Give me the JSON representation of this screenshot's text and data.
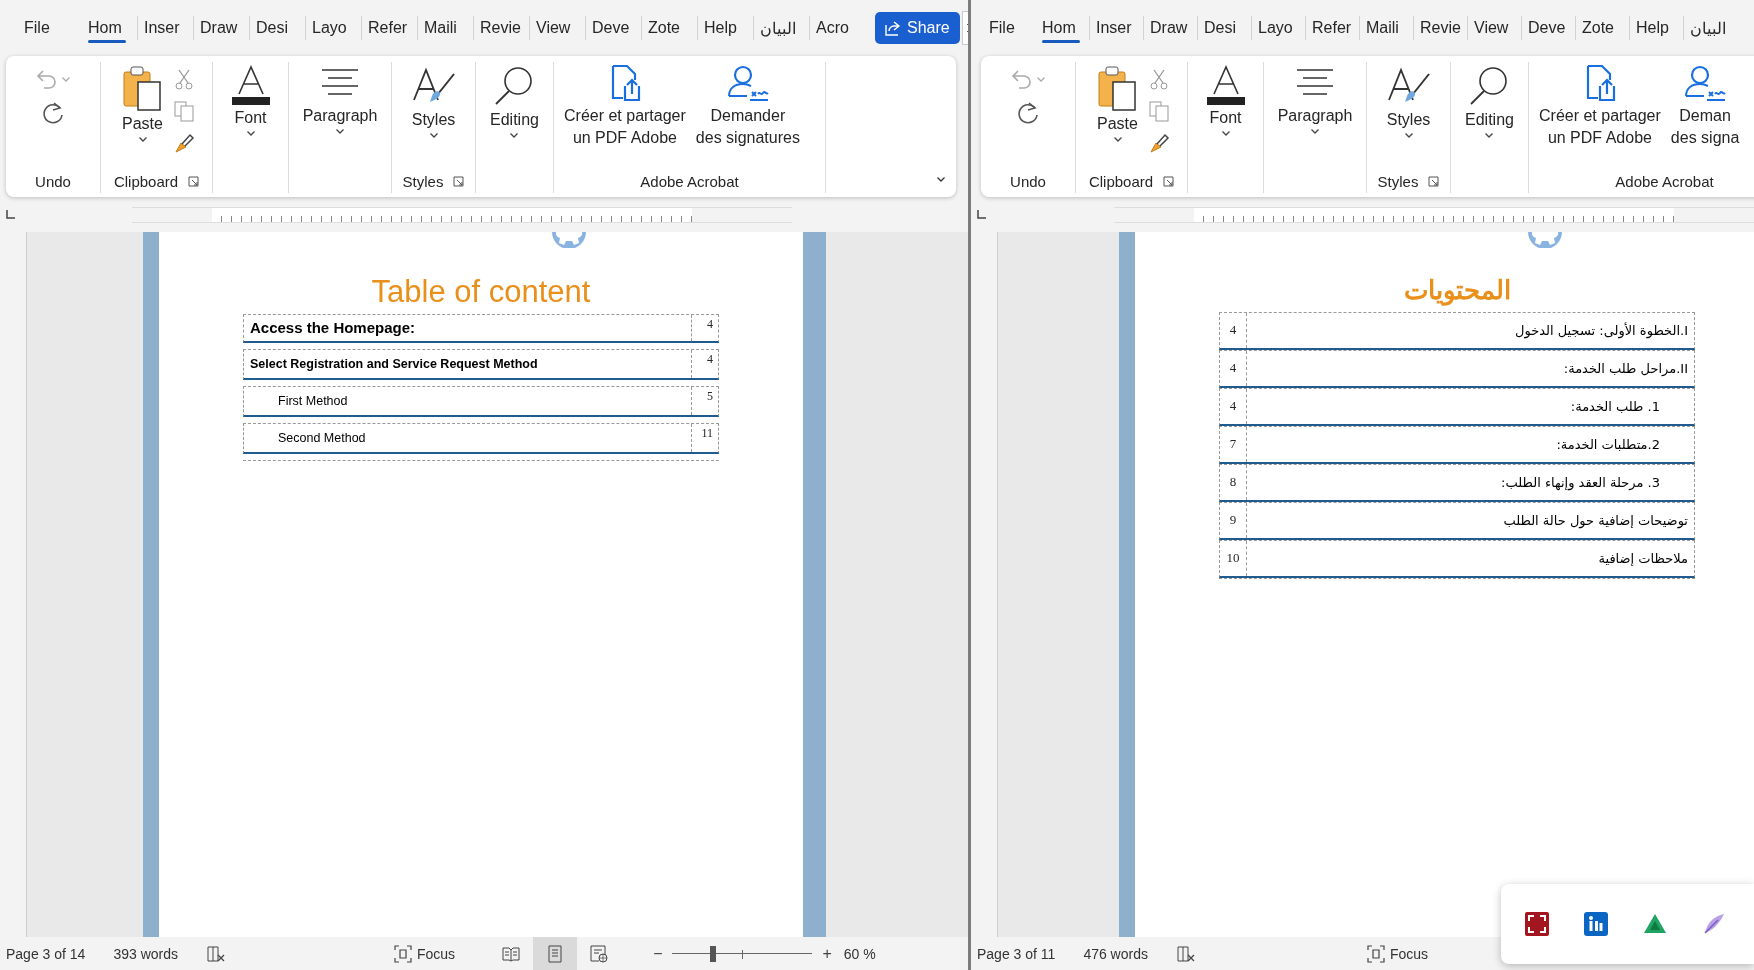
{
  "windows": [
    {
      "tabs": [
        {
          "label": "File",
          "selected": false
        },
        {
          "label": "Hom",
          "selected": true
        },
        {
          "label": "Inser",
          "selected": false
        },
        {
          "label": "Draw",
          "selected": false
        },
        {
          "label": "Desi",
          "selected": false
        },
        {
          "label": "Layo",
          "selected": false
        },
        {
          "label": "Refer",
          "selected": false
        },
        {
          "label": "Maili",
          "selected": false
        },
        {
          "label": "Revie",
          "selected": false
        },
        {
          "label": "View",
          "selected": false
        },
        {
          "label": "Deve",
          "selected": false
        },
        {
          "label": "Zote",
          "selected": false
        },
        {
          "label": "Help",
          "selected": false
        },
        {
          "label": "البيان",
          "selected": false
        },
        {
          "label": "Acro",
          "selected": false
        }
      ],
      "share": "Share",
      "ribbon": {
        "collapsible": true,
        "groups": [
          {
            "kind": "undo",
            "label": "Undo"
          },
          {
            "kind": "clipboard",
            "label": "Clipboard",
            "button": "Paste"
          },
          {
            "kind": "font",
            "button": "Font"
          },
          {
            "kind": "paragraph",
            "button": "Paragraph"
          },
          {
            "kind": "styles",
            "button": "Styles",
            "label": "Styles"
          },
          {
            "kind": "editing",
            "button": "Editing"
          },
          {
            "kind": "acrobat",
            "label": "Adobe Acrobat",
            "buttons": [
              "Créer et partager\nun PDF Adobe",
              "Demander\ndes signatures"
            ]
          }
        ]
      },
      "document": {
        "title": "Table of content",
        "entries": [
          {
            "kind": "major",
            "text": "Access the Homepage:",
            "page": "4"
          },
          {
            "kind": "minor",
            "text": "Select Registration and Service Request Method",
            "page": "4",
            "children": [
              {
                "text": "First Method",
                "page": "5"
              },
              {
                "text": "Second Method",
                "page": "11"
              }
            ]
          }
        ]
      },
      "status": {
        "page": "Page 3 of 14",
        "words": "393 words",
        "focus": "Focus",
        "views": [
          {
            "kind": "read",
            "selected": false
          },
          {
            "kind": "print",
            "selected": true
          },
          {
            "kind": "web",
            "selected": false
          }
        ],
        "zoom_out": "−",
        "zoom_in": "+",
        "zoom": {
          "level": 0.29
        },
        "zoom_label": "60 %"
      }
    },
    {
      "tabs": [
        {
          "label": "File",
          "selected": false
        },
        {
          "label": "Hom",
          "selected": true
        },
        {
          "label": "Inser",
          "selected": false
        },
        {
          "label": "Draw",
          "selected": false
        },
        {
          "label": "Desi",
          "selected": false
        },
        {
          "label": "Layo",
          "selected": false
        },
        {
          "label": "Refer",
          "selected": false
        },
        {
          "label": "Maili",
          "selected": false
        },
        {
          "label": "Revie",
          "selected": false
        },
        {
          "label": "View",
          "selected": false
        },
        {
          "label": "Deve",
          "selected": false
        },
        {
          "label": "Zote",
          "selected": false
        },
        {
          "label": "Help",
          "selected": false
        },
        {
          "label": "البيان",
          "selected": false
        }
      ],
      "ribbon": {
        "groups": [
          {
            "kind": "undo",
            "label": "Undo"
          },
          {
            "kind": "clipboard",
            "label": "Clipboard",
            "button": "Paste"
          },
          {
            "kind": "font",
            "button": "Font"
          },
          {
            "kind": "paragraph",
            "button": "Paragraph"
          },
          {
            "kind": "styles",
            "button": "Styles",
            "label": "Styles"
          },
          {
            "kind": "editing",
            "button": "Editing"
          },
          {
            "kind": "acrobat",
            "label": "Adobe Acrobat",
            "buttons": [
              "Créer et partager\nun PDF Adobe",
              "Deman\ndes signa"
            ]
          }
        ]
      },
      "document": {
        "title": "المحتويات",
        "entries": [
          {
            "kind": "plain",
            "text": "I.الخطوة الأولى: تسجيل الدخول",
            "page": "4"
          },
          {
            "kind": "plain",
            "text": "II.مراحل طلب الخدمة:",
            "page": "4",
            "children": [
              {
                "text": "1. طلب الخدمة:",
                "page": "4"
              },
              {
                "text": "2.متطلبات الخدمة:",
                "page": "7"
              },
              {
                "text": "3. مرحلة العقد وإنهاء الطلب:",
                "page": "8"
              }
            ]
          },
          {
            "kind": "plain",
            "text": "توضيحات إضافية حول حالة الطلب",
            "page": "9"
          },
          {
            "kind": "plain",
            "text": "ملاحظات إضافية",
            "page": "10"
          }
        ]
      },
      "status": {
        "page": "Page 3 of 11",
        "words": "476 words",
        "focus": "Focus"
      }
    }
  ]
}
